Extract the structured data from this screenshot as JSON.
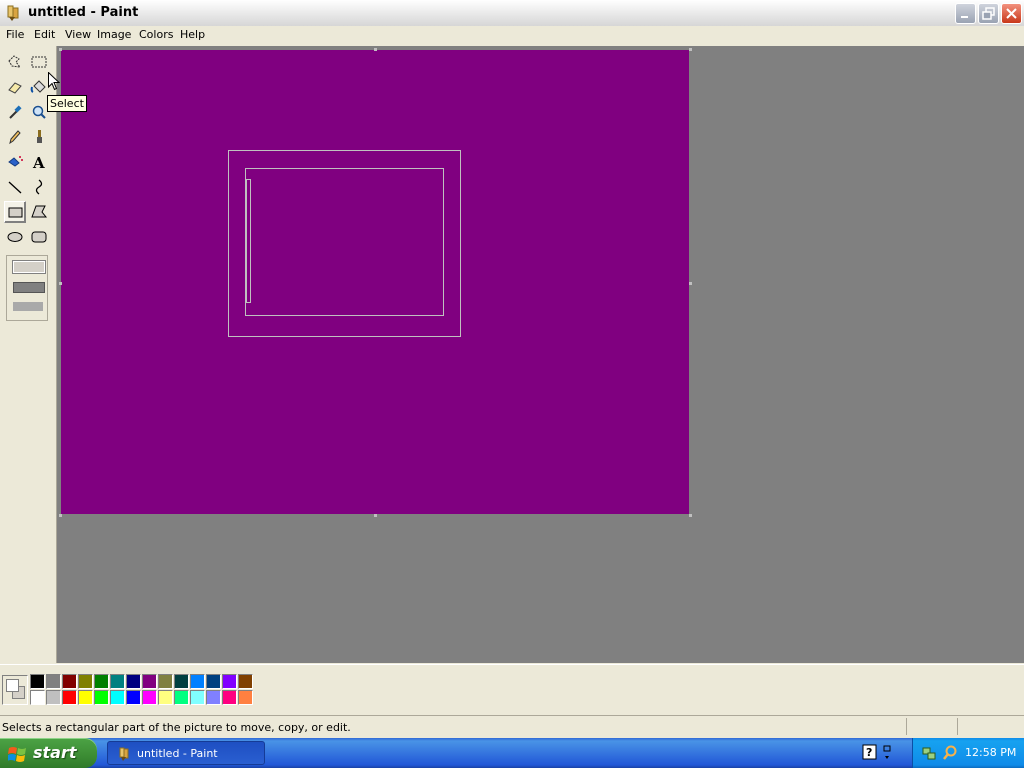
{
  "window": {
    "title": "untitled - Paint"
  },
  "menu": {
    "items": [
      "File",
      "Edit",
      "View",
      "Image",
      "Colors",
      "Help"
    ]
  },
  "tools": [
    "free-form-select",
    "select",
    "eraser",
    "fill-with-color",
    "pick-color",
    "magnifier",
    "pencil",
    "brush",
    "airbrush",
    "text",
    "line",
    "curve",
    "rectangle",
    "polygon",
    "ellipse",
    "rounded-rectangle"
  ],
  "active_tool": "rectangle",
  "tooltip": {
    "text": "Select"
  },
  "canvas": {
    "background": "#800080",
    "stroke": "#c0c0c0"
  },
  "colors": {
    "foreground": "#ffffff",
    "background": "#d4d0c8",
    "palette_top": [
      "#000000",
      "#808080",
      "#800000",
      "#808000",
      "#008000",
      "#008080",
      "#000080",
      "#800080",
      "#808040",
      "#004040",
      "#0080ff",
      "#004080",
      "#8000ff",
      "#804000"
    ],
    "palette_bottom": [
      "#ffffff",
      "#c0c0c0",
      "#ff0000",
      "#ffff00",
      "#00ff00",
      "#00ffff",
      "#0000ff",
      "#ff00ff",
      "#ffff80",
      "#00ff80",
      "#80ffff",
      "#8080ff",
      "#ff0080",
      "#ff8040"
    ]
  },
  "status": {
    "text": "Selects a rectangular part of the picture to move, copy, or edit."
  },
  "taskbar": {
    "start_label": "start",
    "task_button_label": "untitled - Paint",
    "clock": "12:58 PM"
  }
}
